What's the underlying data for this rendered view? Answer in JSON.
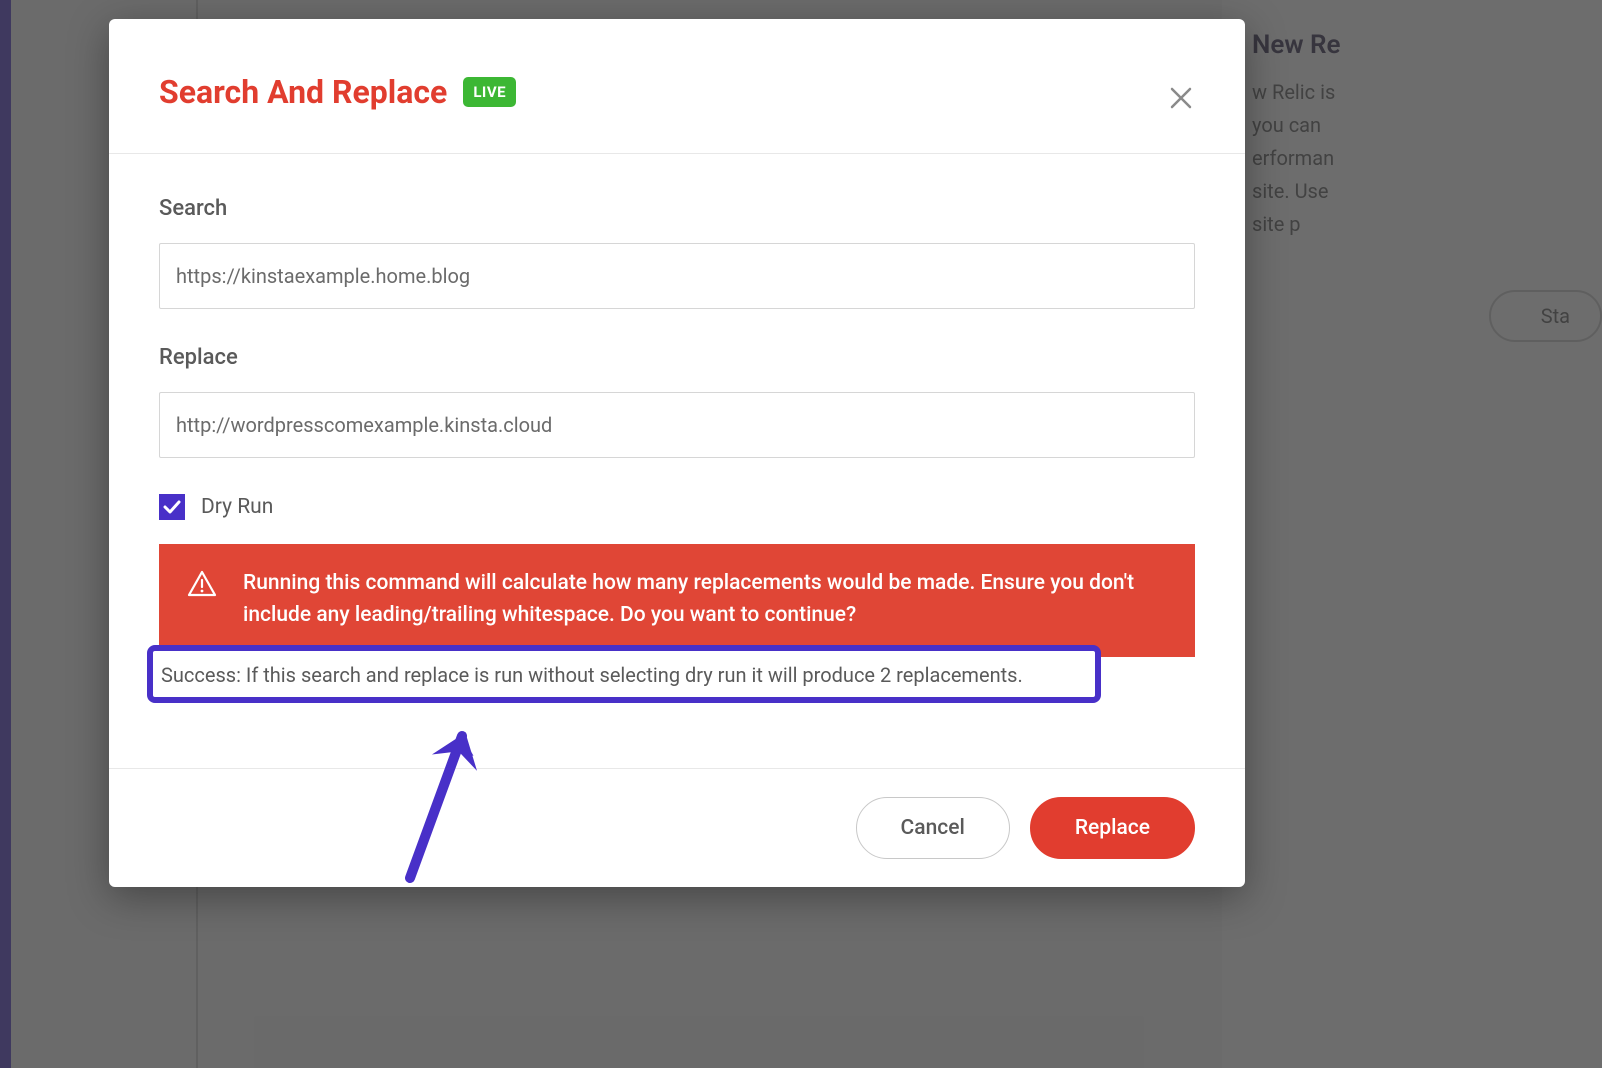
{
  "background": {
    "card_title": "New Re",
    "card_text_line1": "w Relic is",
    "card_text_line2": "you can",
    "card_text_line3": "erforman",
    "card_text_line4": "site. Use",
    "card_text_line5": "site p",
    "pill_label": "Sta"
  },
  "modal": {
    "title": "Search And Replace",
    "badge": "LIVE",
    "search_label": "Search",
    "search_value": "https://kinstaexample.home.blog",
    "replace_label": "Replace",
    "replace_value": "http://wordpresscomexample.kinsta.cloud",
    "dry_run_label": "Dry Run",
    "dry_run_checked": true,
    "warning_text": "Running this command will calculate how many replacements would be made. Ensure you don't include any leading/trailing whitespace. Do you want to continue?",
    "success_text": "Success: If this search and replace is run without selecting dry run it will produce 2 replacements.",
    "cancel_label": "Cancel",
    "replace_button_label": "Replace"
  }
}
